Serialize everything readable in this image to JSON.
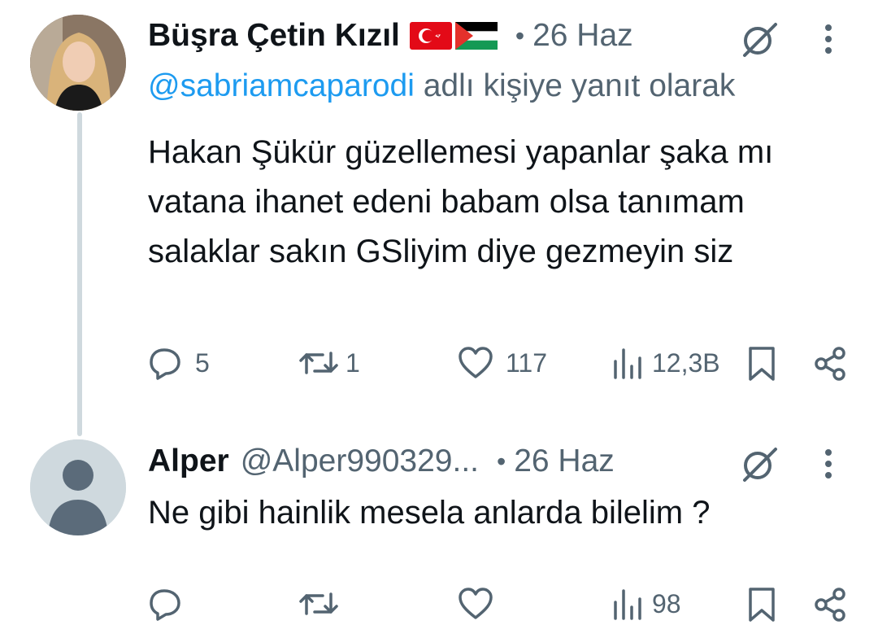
{
  "tweet1": {
    "author_name": "Büşra Çetin Kızıl",
    "flags": [
      "turkey-flag",
      "palestine-flag"
    ],
    "date": "26 Haz",
    "reply_mention": "@sabriamcaparodi",
    "reply_suffix": " adlı kişiye yanıt olarak",
    "text": "Hakan Şükür güzellemesi yapanlar şaka mı vatana ihanet edeni babam olsa tanımam salaklar sakın GSliyim diye gezmeyin siz",
    "replies": "5",
    "retweets": "1",
    "likes": "117",
    "views": "12,3B"
  },
  "tweet2": {
    "author_name": "Alper",
    "handle": "@Alper990329...",
    "date": "26 Haz",
    "text": "Ne gibi hainlik mesela anlarda bilelim ?",
    "replies": "",
    "retweets": "",
    "likes": "",
    "views": "98"
  },
  "separator": "•",
  "colors": {
    "text": "#0f1419",
    "secondary": "#536471",
    "link": "#1d9bf0",
    "thread_line": "#cfd9de"
  }
}
